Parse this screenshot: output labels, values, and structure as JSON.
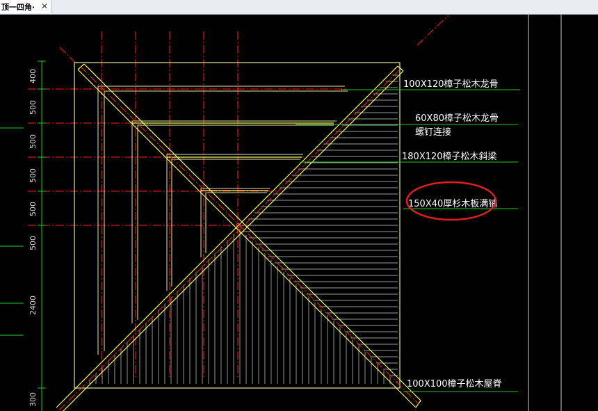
{
  "tab": {
    "title": "顶一四角·",
    "close_glyph": "✕"
  },
  "drawing": {
    "labels": {
      "purlin_main": "100X120樟子松木龙骨",
      "purlin_secondary": "60X80樟子松木龙骨",
      "screw_note": "螺钉连接",
      "hip_beam": "180X120樟子松木斜梁",
      "board": "150X40厚杉木板满铺",
      "ridge": "100X100樟子松木屋脊"
    },
    "dimensions": [
      "400",
      "500",
      "500",
      "500",
      "500",
      "500",
      "2400",
      "300"
    ],
    "highlight_color": "#e02020",
    "line_colors": {
      "outline": "#e6e6a0",
      "beam": "#ffff66",
      "centerline": "#ff2020",
      "leader": "#22cc22",
      "hatch": "#d0d0d0",
      "frame": "#cfcfcf"
    }
  }
}
